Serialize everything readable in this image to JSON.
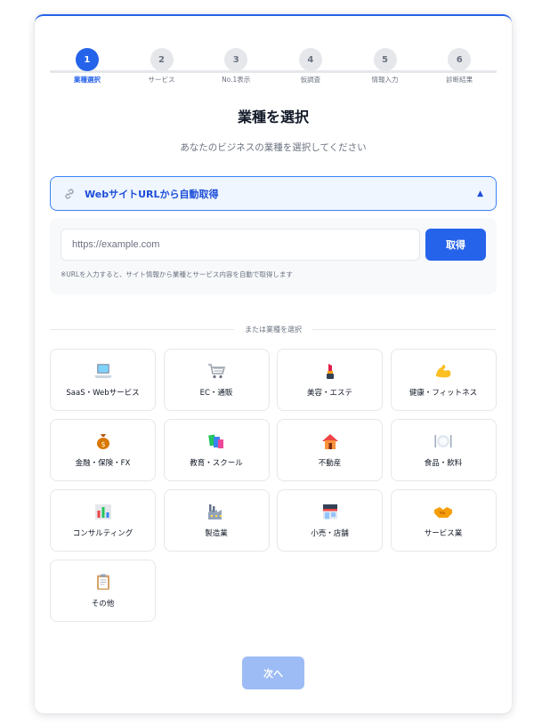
{
  "stepper": {
    "steps": [
      {
        "num": "1",
        "label": "業種選択"
      },
      {
        "num": "2",
        "label": "サービス"
      },
      {
        "num": "3",
        "label": "No.1表示"
      },
      {
        "num": "4",
        "label": "仮調査"
      },
      {
        "num": "5",
        "label": "情報入力"
      },
      {
        "num": "6",
        "label": "診断結果"
      }
    ],
    "active_step": 1
  },
  "header": {
    "title": "業種を選択",
    "subtitle": "あなたのビジネスの業種を選択してください"
  },
  "url_fetch": {
    "toggle_label": "WebサイトURLから自動取得",
    "toggle_icon": "link-icon",
    "expanded_indicator": "▲",
    "input_placeholder": "https://example.com",
    "input_value": "",
    "button_label": "取得",
    "note": "※URLを入力すると、サイト情報から業種とサービス内容を自動で取得します"
  },
  "divider": {
    "text": "または業種を選択"
  },
  "industries": [
    {
      "label": "SaaS・Webサービス",
      "icon": "laptop-icon"
    },
    {
      "label": "EC・通販",
      "icon": "shopping-cart-icon"
    },
    {
      "label": "美容・エステ",
      "icon": "lipstick-icon"
    },
    {
      "label": "健康・フィットネス",
      "icon": "flexed-biceps-icon"
    },
    {
      "label": "金融・保険・FX",
      "icon": "money-bag-icon"
    },
    {
      "label": "教育・スクール",
      "icon": "books-icon"
    },
    {
      "label": "不動産",
      "icon": "house-icon"
    },
    {
      "label": "食品・飲料",
      "icon": "plate-cutlery-icon"
    },
    {
      "label": "コンサルティング",
      "icon": "bar-chart-icon"
    },
    {
      "label": "製造業",
      "icon": "factory-icon"
    },
    {
      "label": "小売・店舗",
      "icon": "convenience-store-icon"
    },
    {
      "label": "サービス業",
      "icon": "handshake-icon"
    },
    {
      "label": "その他",
      "icon": "clipboard-icon"
    }
  ],
  "footer": {
    "next_label": "次へ"
  },
  "colors": {
    "accent": "#2563eb",
    "accent_light": "#eff6ff",
    "disabled_button": "#9dbcf5",
    "border": "#e5e7eb",
    "muted_text": "#6b7280"
  }
}
